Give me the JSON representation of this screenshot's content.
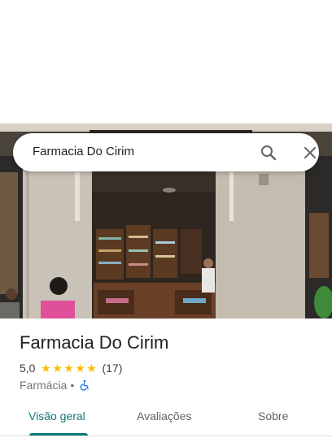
{
  "search": {
    "query": "Farmacia Do Cirim"
  },
  "place": {
    "name": "Farmacia Do Cirim",
    "rating": "5,0",
    "stars": 5,
    "review_count": "(17)",
    "category": "Farmácia",
    "separator": "•"
  },
  "tabs": [
    {
      "label": "Visão geral",
      "active": true
    },
    {
      "label": "Avaliações",
      "active": false
    },
    {
      "label": "Sobre",
      "active": false
    }
  ],
  "colors": {
    "accent": "#0b7a75",
    "star": "#fbbc04",
    "wheelchair": "#1a73e8"
  },
  "icons": [
    "search-icon",
    "close-icon",
    "star-icon",
    "wheelchair-accessible-icon"
  ]
}
